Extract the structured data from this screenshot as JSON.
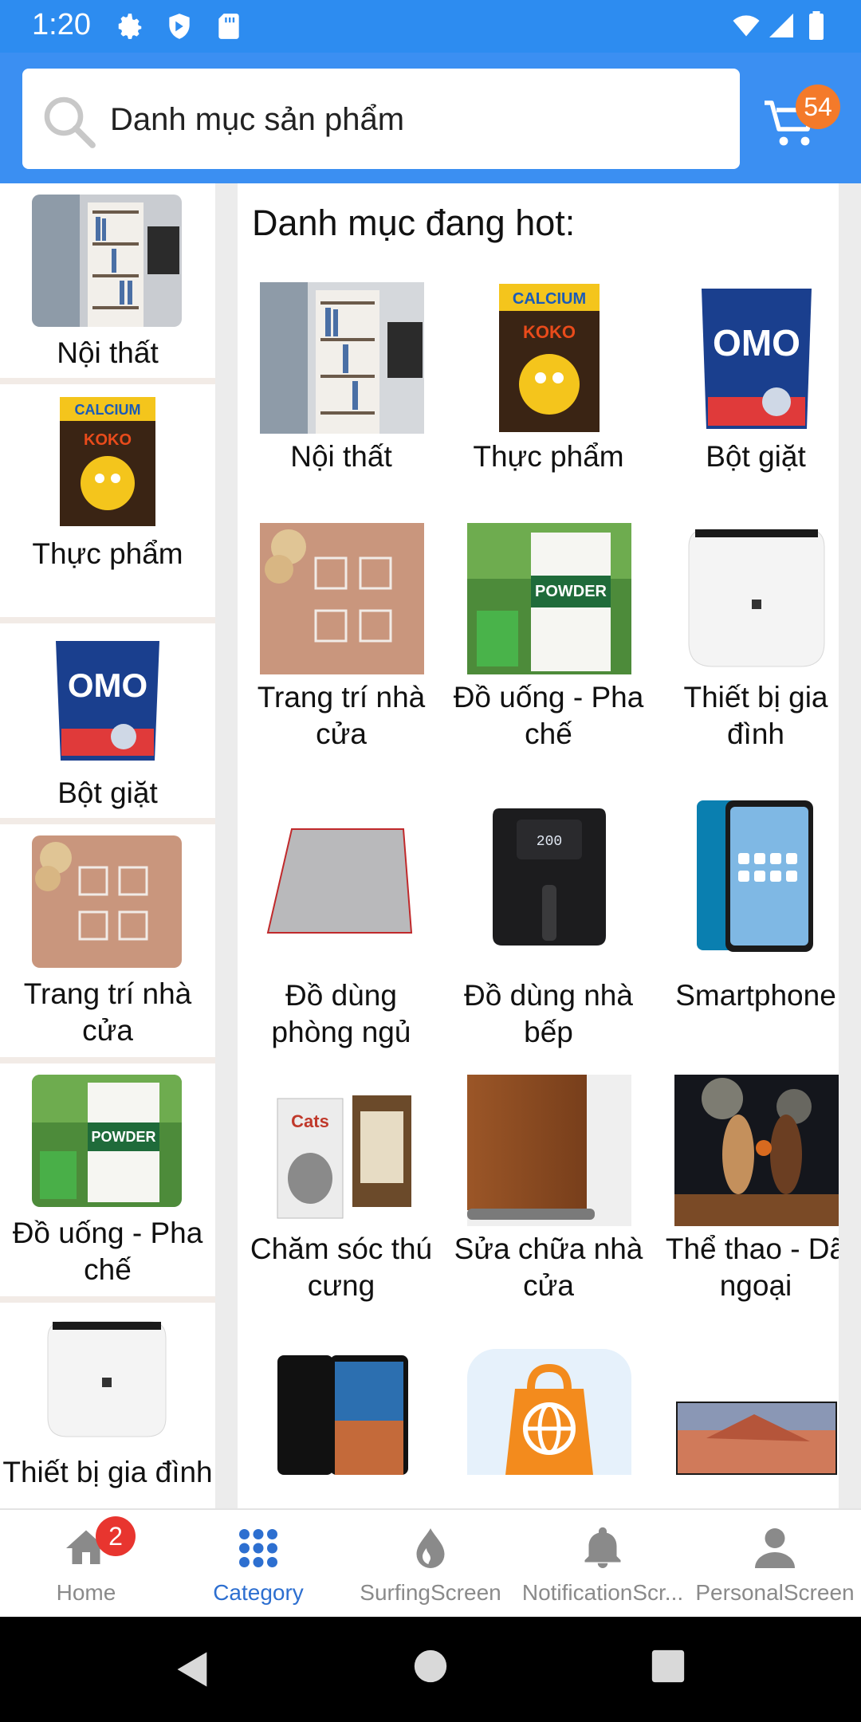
{
  "status_bar": {
    "time": "1:20",
    "icons_left": [
      "gear-icon",
      "shield-icon",
      "sd-card-icon"
    ],
    "icons_right": [
      "wifi-icon",
      "signal-icon",
      "battery-icon"
    ]
  },
  "header": {
    "search_placeholder": "Danh mục sản phẩm",
    "cart_count": "54"
  },
  "sidebar": {
    "items": [
      {
        "label": "Nội thất",
        "image": "bookshelf"
      },
      {
        "label": "Thực phẩm",
        "image": "cereal"
      },
      {
        "label": "Bột giặt",
        "image": "detergent"
      },
      {
        "label": "Trang trí nhà cửa",
        "image": "hooks"
      },
      {
        "label": "Đồ uống - Pha chế",
        "image": "powder"
      },
      {
        "label": "Thiết bị gia đình",
        "image": "purifier"
      }
    ]
  },
  "main": {
    "heading": "Danh mục đang hot:",
    "categories": [
      {
        "label": "Nội thất",
        "image": "bookshelf"
      },
      {
        "label": "Thực phẩm",
        "image": "cereal"
      },
      {
        "label": "Bột giặt",
        "image": "detergent"
      },
      {
        "label": "Trang trí nhà cửa",
        "image": "hooks"
      },
      {
        "label": "Đồ uống - Pha chế",
        "image": "powder"
      },
      {
        "label": "Thiết bị gia đình",
        "image": "purifier"
      },
      {
        "label": "Đồ dùng phòng ngủ",
        "image": "mat"
      },
      {
        "label": "Đồ dùng nhà bếp",
        "image": "airfryer"
      },
      {
        "label": "Smartphone",
        "image": "phone"
      },
      {
        "label": "Chăm sóc thú cưng",
        "image": "catfood"
      },
      {
        "label": "Sửa chữa nhà cửa",
        "image": "door"
      },
      {
        "label": "Thể thao - Dã ngoại",
        "image": "basketball"
      },
      {
        "label": "",
        "image": "phone2"
      },
      {
        "label": "",
        "image": "bag"
      },
      {
        "label": "",
        "image": "tv"
      }
    ]
  },
  "bottom_nav": {
    "items": [
      {
        "label": "Home",
        "icon": "home-icon",
        "badge": "2"
      },
      {
        "label": "Category",
        "icon": "grid-icon"
      },
      {
        "label": "SurfingScreen",
        "icon": "drop-icon"
      },
      {
        "label": "NotificationScr...",
        "icon": "bell-icon"
      },
      {
        "label": "PersonalScreen",
        "icon": "person-icon"
      }
    ],
    "active": "Category"
  },
  "colors": {
    "primary": "#3b8ff2",
    "status_bar": "#2d8cf0",
    "badge": "#f47a2a",
    "active_nav": "#2d6fd0",
    "nav_badge": "#e8352f"
  }
}
